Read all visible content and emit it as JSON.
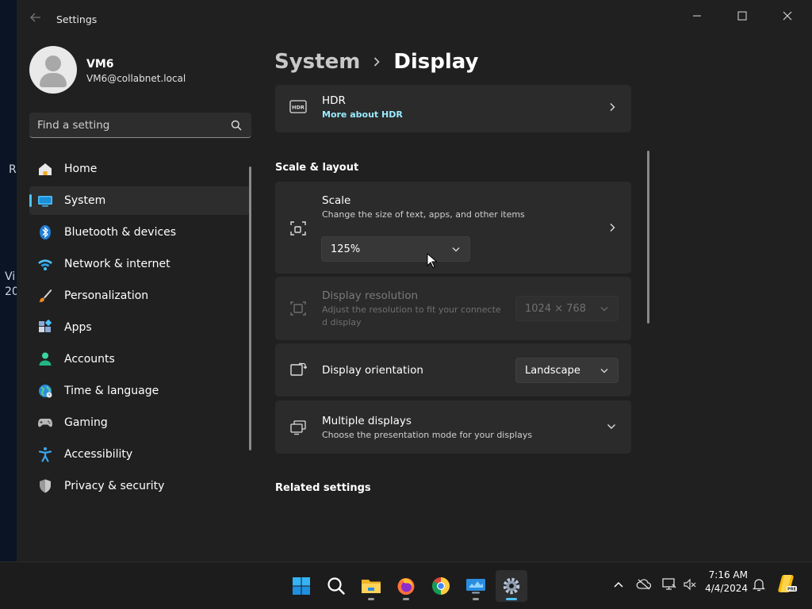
{
  "desktop": {
    "fragments": [
      "R",
      "Vi",
      "20"
    ]
  },
  "window": {
    "title": "Settings",
    "back_icon": "arrow-left-icon"
  },
  "profile": {
    "name": "VM6",
    "email": "VM6@collabnet.local"
  },
  "search": {
    "placeholder": "Find a setting"
  },
  "nav": {
    "items": [
      {
        "label": "Home",
        "icon": "home-icon"
      },
      {
        "label": "System",
        "icon": "system-icon",
        "active": true
      },
      {
        "label": "Bluetooth & devices",
        "icon": "bluetooth-icon"
      },
      {
        "label": "Network & internet",
        "icon": "wifi-icon"
      },
      {
        "label": "Personalization",
        "icon": "brush-icon"
      },
      {
        "label": "Apps",
        "icon": "apps-icon"
      },
      {
        "label": "Accounts",
        "icon": "person-icon"
      },
      {
        "label": "Time & language",
        "icon": "globe-icon"
      },
      {
        "label": "Gaming",
        "icon": "gamepad-icon"
      },
      {
        "label": "Accessibility",
        "icon": "accessibility-icon"
      },
      {
        "label": "Privacy & security",
        "icon": "shield-icon"
      }
    ]
  },
  "breadcrumb": {
    "parent": "System",
    "current": "Display"
  },
  "hdr": {
    "title": "HDR",
    "link": "More about HDR"
  },
  "scale_layout": {
    "heading": "Scale & layout",
    "scale": {
      "title": "Scale",
      "subtitle": "Change the size of text, apps, and other items",
      "value": "125%"
    },
    "resolution": {
      "title": "Display resolution",
      "subtitle_line1": "Adjust the resolution to fit your connecte",
      "subtitle_line2": "d display",
      "value": "1024 × 768"
    },
    "orientation": {
      "title": "Display orientation",
      "value": "Landscape"
    },
    "multiple": {
      "title": "Multiple displays",
      "subtitle": "Choose the presentation mode for your displays"
    }
  },
  "related": {
    "heading": "Related settings"
  },
  "taskbar": {
    "apps": [
      "start-icon",
      "search-icon",
      "file-explorer-icon",
      "firefox-icon",
      "chrome-icon",
      "remote-desktop-icon",
      "settings-icon"
    ],
    "clock": {
      "time": "7:16 AM",
      "date": "4/4/2024"
    }
  },
  "colors": {
    "accent": "#4cc2ff",
    "link": "#99ebff",
    "window_bg": "#202020",
    "card_bg": "#2b2b2b"
  }
}
